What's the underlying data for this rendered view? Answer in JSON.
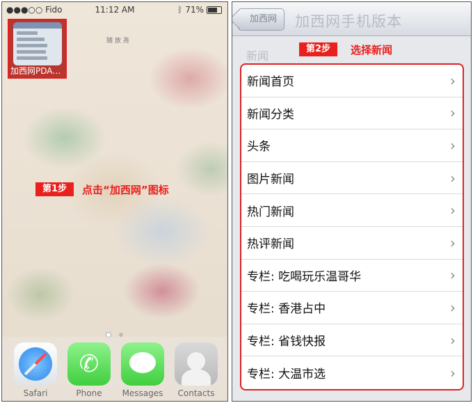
{
  "left": {
    "status": {
      "carrier": "●●●○○ Fido",
      "time": "11:12 AM",
      "battery": "71%"
    },
    "app_icon": {
      "label": "加西网PDA…"
    },
    "watermark": "随 放 尧",
    "step1": {
      "badge": "第1步",
      "text": "点击“加西网”图标"
    },
    "dock": [
      {
        "label": "Safari",
        "icon": "safari-icon"
      },
      {
        "label": "Phone",
        "icon": "phone-icon"
      },
      {
        "label": "Messages",
        "icon": "messages-icon"
      },
      {
        "label": "Contacts",
        "icon": "contacts-icon"
      }
    ]
  },
  "right": {
    "back_button": "加西网",
    "title": "加西网手机版本",
    "section_label": "新闻",
    "step2": {
      "badge": "第2步",
      "text": "选择新闻"
    },
    "items": [
      {
        "label": "新闻首页"
      },
      {
        "label": "新闻分类"
      },
      {
        "label": "头条"
      },
      {
        "label": "图片新闻"
      },
      {
        "label": "热门新闻"
      },
      {
        "label": "热评新闻"
      },
      {
        "label": "专栏: 吃喝玩乐温哥华"
      },
      {
        "label": "专栏: 香港占中"
      },
      {
        "label": "专栏: 省钱快报"
      },
      {
        "label": "专栏: 大温市选"
      }
    ]
  },
  "colors": {
    "highlight_red": "#e8201e"
  }
}
